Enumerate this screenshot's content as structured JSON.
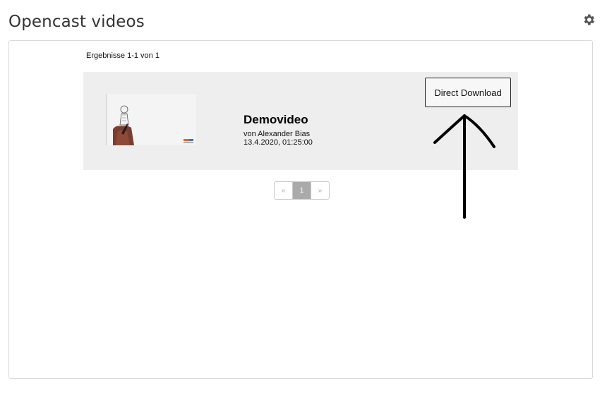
{
  "block": {
    "title": "Opencast videos",
    "settings_icon": "gear-icon"
  },
  "results": {
    "summary": "Ergebnisse 1-1 von 1"
  },
  "video": {
    "title": "Demovideo",
    "author": "von Alexander Bias",
    "date": "13.4.2020, 01:25:00",
    "download_label": "Direct Download"
  },
  "pagination": {
    "prev": "«",
    "current": "1",
    "next": "»"
  },
  "colors": {
    "card_background": "#eeeeee",
    "pagination_active": "#aaaaaa",
    "title_text": "#333333"
  }
}
